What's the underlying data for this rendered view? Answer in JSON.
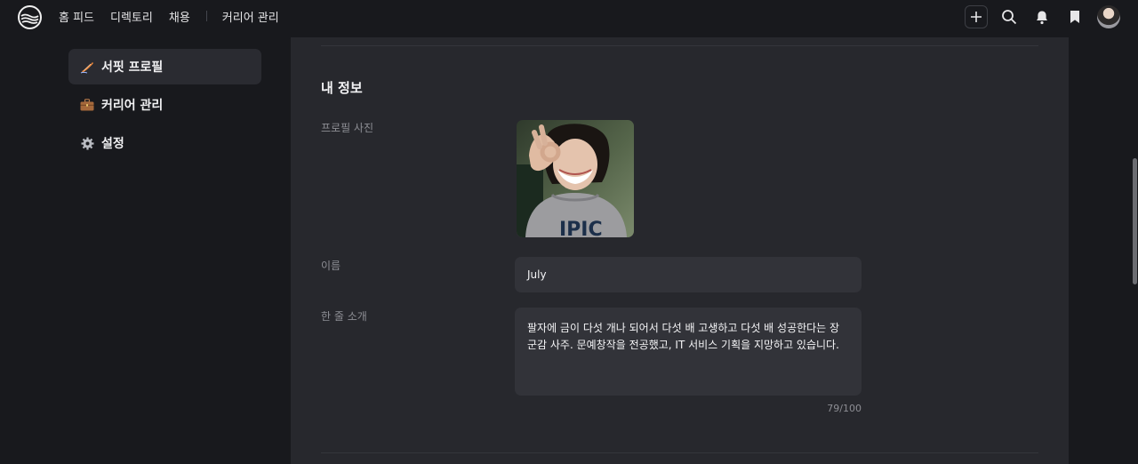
{
  "nav": {
    "items": [
      "홈 피드",
      "디렉토리",
      "채용"
    ],
    "career": "커리어 관리"
  },
  "top_actions": [
    "plus-icon",
    "search-icon",
    "bell-icon",
    "bookmark-icon",
    "avatar"
  ],
  "sidebar": {
    "items": [
      {
        "label": "서핏 프로필",
        "icon": "surf-icon",
        "active": true
      },
      {
        "label": "커리어 관리",
        "icon": "briefcase-icon",
        "active": false
      },
      {
        "label": "설정",
        "icon": "gear-icon",
        "active": false
      }
    ]
  },
  "profile": {
    "section_title": "내 정보",
    "photo_label": "프로필 사진",
    "name_label": "이름",
    "name_value": "July",
    "bio_label": "한 줄 소개",
    "bio_value": "팔자에 금이 다섯 개나 되어서 다섯 배 고생하고 다섯 배 성공한다는 장군감 사주. 문예창작을 전공했고, IT 서비스 기획을 지망하고 있습니다.",
    "bio_counter": "79/100"
  },
  "colors": {
    "background": "#18191d",
    "panel": "#27282d",
    "field": "#323339",
    "active_item": "#2a2b31",
    "muted_text": "#8d8e94"
  }
}
